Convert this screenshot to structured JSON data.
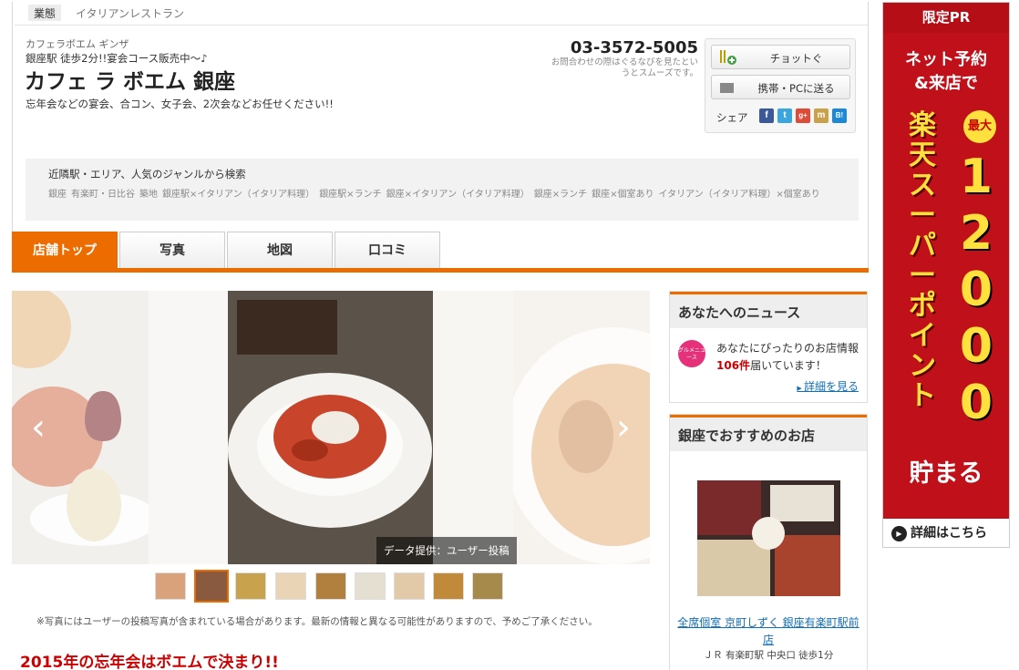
{
  "category": {
    "tag": "業態",
    "value": "イタリアンレストラン"
  },
  "shop": {
    "kana": "カフェラボエム ギンザ",
    "access": "銀座駅 徒歩2分!!宴会コース販売中～♪",
    "name": "カフェ ラ ボエム 銀座",
    "catch": "忘年会などの宴会、合コン、女子会、2次会などお任せください!!",
    "phone": "03-3572-5005",
    "phone_note": "お問合わせの際はぐるなびを見たというとスムーズです。"
  },
  "actions": {
    "chotto_label": "チョットぐ",
    "send_label": "携帯・PCに送る",
    "share_label": "シェア"
  },
  "sns": [
    "f",
    "t",
    "g+",
    "m",
    "B!"
  ],
  "nearby": {
    "title": "近隣駅・エリア、人気のジャンルから検索",
    "links": [
      "銀座",
      "有楽町・日比谷",
      "築地",
      "銀座駅×イタリアン（イタリア料理）",
      "銀座駅×ランチ",
      "銀座×イタリアン（イタリア料理）",
      "銀座×ランチ",
      "銀座×個室あり",
      "イタリアン（イタリア料理）×個室あり"
    ]
  },
  "tabs": [
    "店舗トップ",
    "写真",
    "地図",
    "口コミ"
  ],
  "gallery": {
    "credit": "データ提供：ユーザー投稿",
    "note": "※写真にはユーザーの投稿写真が含まれている場合があります。最新の情報と異なる可能性がありますので、予めご了承ください。",
    "prev": "‹",
    "next": "›"
  },
  "promo_heading": "2015年の忘年会はボエムで決まり!!",
  "news": {
    "title": "あなたへのニュース",
    "icon_text": "グルメニュース",
    "line1": "あなたにぴったりのお店情報",
    "count": "106件",
    "line2": "届いています！",
    "link": "詳細を見る"
  },
  "recommend": {
    "title": "銀座でおすすめのお店",
    "name": "全席個室 京町しずく 銀座有楽町駅前店",
    "access": "ＪＲ 有楽町駅 中央口 徒歩1分"
  },
  "ad": {
    "pr": "限定PR",
    "copy1": "ネット予約",
    "copy2": "&来店で",
    "max": "最大",
    "big": "12000",
    "vertical": "楽天スーパーポイント",
    "save": "貯まる",
    "detail": "詳細はこちら"
  },
  "colors": {
    "accent": "#ec6c00",
    "link": "#136eb5",
    "red": "#c00",
    "ad_bg": "#c0101a"
  }
}
